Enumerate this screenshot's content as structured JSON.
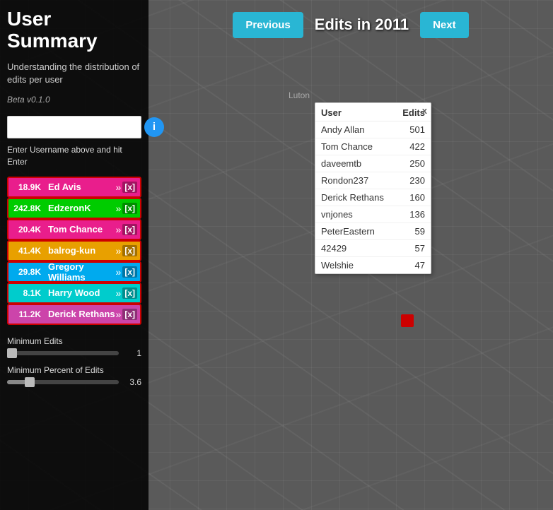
{
  "app": {
    "title": "User Summary",
    "subtitle": "Understanding the distribution of edits per user",
    "version": "Beta v0.1.0"
  },
  "header": {
    "year_label": "Edits in 2011",
    "prev_label": "Previous",
    "next_label": "Next"
  },
  "search": {
    "placeholder": "",
    "hint": "Enter Username above and hit Enter"
  },
  "info_icon": "i",
  "users": [
    {
      "count": "18.9K",
      "name": "Ed Avis",
      "color": "#e91e8c"
    },
    {
      "count": "242.8K",
      "name": "EdzeronK",
      "color": "#00cc00"
    },
    {
      "count": "20.4K",
      "name": "Tom Chance",
      "color": "#e91e8c"
    },
    {
      "count": "41.4K",
      "name": "balrog-kun",
      "color": "#e8a000"
    },
    {
      "count": "29.8K",
      "name": "Gregory Williams",
      "color": "#00aaee"
    },
    {
      "count": "8.1K",
      "name": "Harry Wood",
      "color": "#00cccc"
    },
    {
      "count": "11.2K",
      "name": "Derick Rethans",
      "color": "#cc44aa"
    }
  ],
  "sliders": {
    "min_edits_label": "Minimum Edits",
    "min_edits_value": "1",
    "min_edits_fill_pct": 2,
    "min_percent_label": "Minimum Percent of Edits",
    "min_percent_value": "3.6",
    "min_percent_fill_pct": 18
  },
  "popup": {
    "close": "x",
    "col_user": "User",
    "col_edits": "Edits",
    "rows": [
      {
        "user": "Andy Allan",
        "edits": 501
      },
      {
        "user": "Tom Chance",
        "edits": 422
      },
      {
        "user": "daveemtb",
        "edits": 250
      },
      {
        "user": "Rondon237",
        "edits": 230
      },
      {
        "user": "Derick Rethans",
        "edits": 160
      },
      {
        "user": "vnjones",
        "edits": 136
      },
      {
        "user": "PeterEastern",
        "edits": 59
      },
      {
        "user": "42429",
        "edits": 57
      },
      {
        "user": "Welshie",
        "edits": 47
      }
    ]
  },
  "map": {
    "luton_label": "Luton"
  }
}
